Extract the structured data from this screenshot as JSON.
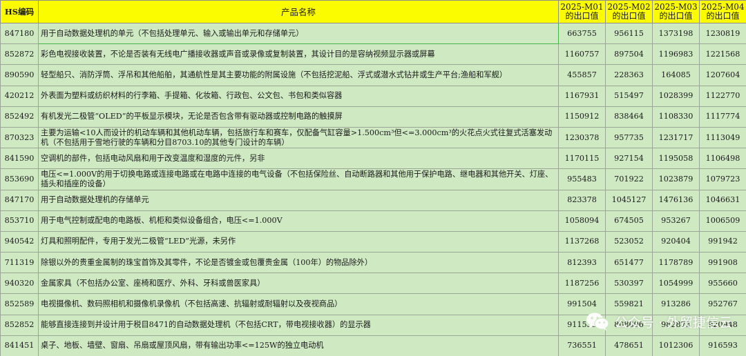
{
  "header": {
    "hs": "HS编码",
    "name": "产品名称",
    "m1": "2025-M01",
    "m2": "2025-M02",
    "m3": "2025-M03",
    "m4": "2025-M04",
    "sub": "的出口值"
  },
  "rows": [
    {
      "hs": "847180",
      "name": "用于自动数据处理机的单元（不包括处理单元、输入或输出单元和存储单元）",
      "m1": "663755",
      "m2": "956115",
      "m3": "1373198",
      "m4": "1230819"
    },
    {
      "hs": "852872",
      "name": "彩色电视接收装置，不论是否装有无线电广播接收器或声音或录像或复制装置，其设计目的是容纳视频显示器或屏幕",
      "m1": "1160757",
      "m2": "897504",
      "m3": "1196983",
      "m4": "1221568"
    },
    {
      "hs": "890590",
      "name": "轻型船只、消防浮筒、浮吊和其他船舶，其通航性是其主要功能的附属设施（不包括挖泥船、浮式或潜水式钻井或生产平台;渔船和军舰）",
      "m1": "455857",
      "m2": "228363",
      "m3": "164085",
      "m4": "1207604"
    },
    {
      "hs": "420212",
      "name": "外表面为塑料或纺织材料的行李箱、手提箱、化妆箱、行政包、公文包、书包和类似容器",
      "m1": "1167931",
      "m2": "515497",
      "m3": "1028399",
      "m4": "1122770"
    },
    {
      "hs": "852492",
      "name": "有机发光二极管“OLED”的平板显示模块，无论是否包含带有驱动器或控制电路的触摸屏",
      "m1": "1150912",
      "m2": "838464",
      "m3": "1108330",
      "m4": "1117774"
    },
    {
      "hs": "870323",
      "name": "主要为运输<10人而设计的机动车辆和其他机动车辆，包括旅行车和赛车，仅配备气缸容量>1.500cm³但<=3.000cm³的火花点火式往复式活塞发动机（不包括用于雪地行驶的车辆和分目8703.10的其他专门设计的车辆）",
      "m1": "1230378",
      "m2": "957735",
      "m3": "1231717",
      "m4": "1113049"
    },
    {
      "hs": "841590",
      "name": "空调机的部件，包括电动风扇和用于改变温度和湿度的元件，另非",
      "m1": "1170115",
      "m2": "927154",
      "m3": "1195058",
      "m4": "1106498"
    },
    {
      "hs": "853690",
      "name": "电压<=1.000V的用于切换电路或连接电路或在电路中连接的电气设备（不包括保险丝、自动断路器和其他用于保护电路、继电器和其他开关、灯座、插头和插座的设备）",
      "m1": "955483",
      "m2": "701922",
      "m3": "1023879",
      "m4": "1079723"
    },
    {
      "hs": "847170",
      "name": "用于自动数据处理机的存储单元",
      "m1": "823378",
      "m2": "1045127",
      "m3": "1476136",
      "m4": "1046631"
    },
    {
      "hs": "853710",
      "name": "用于电气控制或配电的电路板、机柜和类似设备组合，电压<=1.000V",
      "m1": "1058094",
      "m2": "674505",
      "m3": "953267",
      "m4": "1006509"
    },
    {
      "hs": "940542",
      "name": "灯具和照明配件，专用于发光二极管“LED”光源，未另作",
      "m1": "1137268",
      "m2": "523052",
      "m3": "920404",
      "m4": "991942"
    },
    {
      "hs": "711319",
      "name": "除银以外的贵重金属制的珠宝首饰及其零件，不论是否镀金或包覆贵金属（100年）的物品除外）",
      "m1": "812393",
      "m2": "651477",
      "m3": "1178789",
      "m4": "991908"
    },
    {
      "hs": "940320",
      "name": "金属家具（不包括办公室、座椅和医疗、外科、牙科或兽医家具）",
      "m1": "1187256",
      "m2": "530397",
      "m3": "1054999",
      "m4": "955660"
    },
    {
      "hs": "852589",
      "name": "电视摄像机、数码照相机和摄像机录像机（不包括高速、抗辐射或耐辐射以及夜视商品）",
      "m1": "991504",
      "m2": "559821",
      "m3": "913286",
      "m4": "952767"
    },
    {
      "hs": "852852",
      "name": "能够直接连接到并设计用于税目8471的自动数据处理机（不包括CRT，带电视接收器）的显示器",
      "m1": "911539",
      "m2": "808696",
      "m3": "982873",
      "m4": "920948"
    },
    {
      "hs": "841451",
      "name": "桌子、地板、墙壁、窗扇、吊扇或屋顶风扇，带有输出功率<=125W的独立电动机",
      "m1": "736551",
      "m2": "478651",
      "m3": "1012306",
      "m4": "916593"
    }
  ],
  "watermark": {
    "icon": "wechat-icon",
    "text": "公众号 · 外贸捷信云"
  }
}
